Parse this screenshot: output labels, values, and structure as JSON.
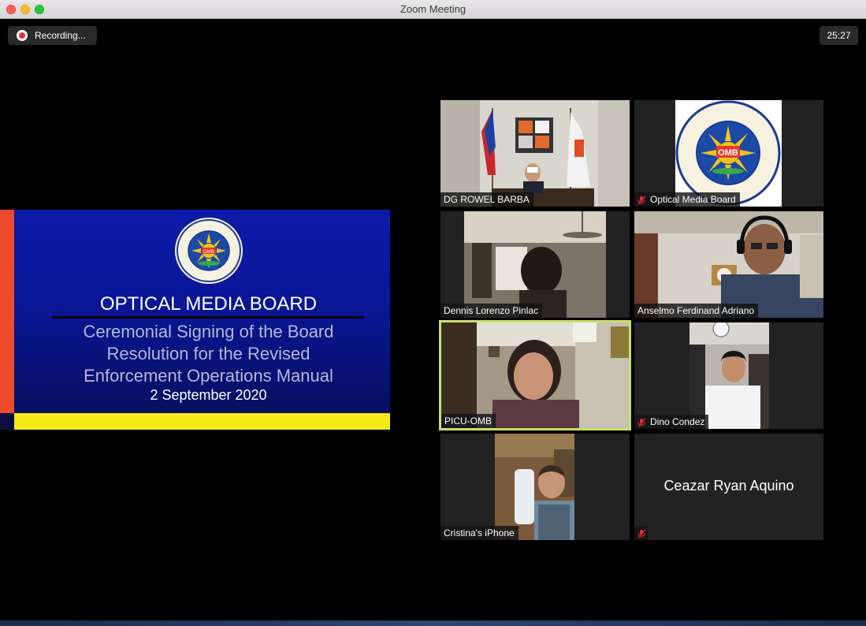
{
  "window": {
    "title": "Zoom Meeting"
  },
  "recording": {
    "label": "Recording..."
  },
  "timer": {
    "value": "25:27"
  },
  "share": {
    "title": "OPTICAL MEDIA BOARD",
    "subtitle_lines": [
      "Ceremonial Signing of the Board",
      "Resolution for the Revised",
      "Enforcement Operations Manual"
    ],
    "date": "2 September 2020",
    "colors": {
      "slide": "#0a1697",
      "left_bar": "#ee4a2b",
      "bottom_bar": "#f6e91a"
    }
  },
  "seal": {
    "text_top": "OPTICAL MEDIA BOARD",
    "text_bottom": "OFFICE OF THE PRESIDENT",
    "center": "OMB"
  },
  "participants": [
    {
      "name": "DG ROWEL BARBA",
      "muted": false,
      "video": true
    },
    {
      "name": "Optical Media Board",
      "muted": true,
      "video": true
    },
    {
      "name": "Dennis Lorenzo Pinlac",
      "muted": false,
      "video": true
    },
    {
      "name": "Anselmo Ferdinand Adriano",
      "muted": false,
      "video": true
    },
    {
      "name": "PICU-OMB",
      "muted": false,
      "video": true,
      "active_speaker": true
    },
    {
      "name": "Dino Condez",
      "muted": true,
      "video": true
    },
    {
      "name": "Cristina's iPhone",
      "muted": false,
      "video": true
    },
    {
      "name": "Ceazar Ryan Aquino",
      "muted": true,
      "video": false
    }
  ],
  "accent": {
    "active_speaker": "#c8e06a",
    "muted_icon": "#e0332b"
  }
}
